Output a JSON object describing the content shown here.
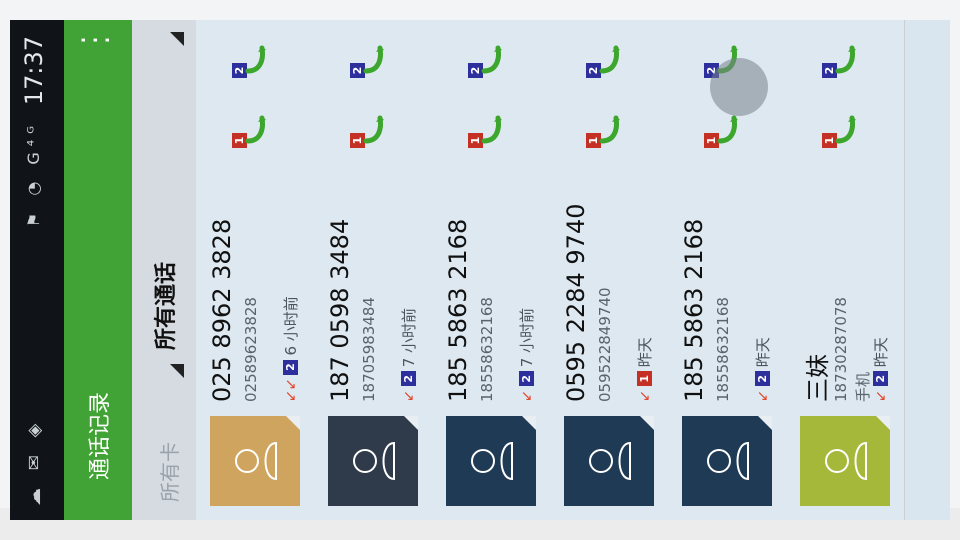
{
  "status_bar": {
    "time": "17:37",
    "icons_left": "☁ ✉ ◈",
    "icons_right": "⚑ ◔ G⁴ᴳ"
  },
  "action_bar": {
    "title": "通话记录",
    "menu_icon": "overflow-menu-icon"
  },
  "filter_bar": {
    "left_label": "所有卡",
    "main_label": "所有通话"
  },
  "calls": [
    {
      "name": "025 8962 3828",
      "number": "02589623828",
      "type_label": "",
      "arrows": "↙↙",
      "sim": "2",
      "time": "6 小时前",
      "avatar_style": "gold",
      "right_btns": [
        {
          "sim": "2"
        },
        {
          "sim": "1"
        }
      ]
    },
    {
      "name": "187 0598 3484",
      "number": "18705983484",
      "type_label": "",
      "arrows": "↙",
      "sim": "2",
      "time": "7 小时前",
      "avatar_style": "dark",
      "right_btns": [
        {
          "sim": "2"
        },
        {
          "sim": "1"
        }
      ]
    },
    {
      "name": "185 5863 2168",
      "number": "18558632168",
      "type_label": "",
      "arrows": "↙",
      "sim": "2",
      "time": "7 小时前",
      "avatar_style": "navy",
      "right_btns": [
        {
          "sim": "2"
        },
        {
          "sim": "1"
        }
      ]
    },
    {
      "name": "0595 2284 9740",
      "number": "059522849740",
      "type_label": "",
      "arrows": "↙",
      "sim": "1",
      "time": "昨天",
      "avatar_style": "navy",
      "right_btns": [
        {
          "sim": "2"
        },
        {
          "sim": "1"
        }
      ]
    },
    {
      "name": "185 5863 2168",
      "number": "18558632168",
      "type_label": "",
      "arrows": "↙",
      "sim": "2",
      "time": "昨天",
      "avatar_style": "navy",
      "right_btns": [
        {
          "sim": "2"
        },
        {
          "sim": "1"
        }
      ]
    },
    {
      "name": "三妹",
      "number": "18730287078",
      "type_label": "手机",
      "arrows": "↙",
      "sim": "2",
      "time": "昨天",
      "avatar_style": "olive",
      "right_btns": [
        {
          "sim": "2"
        },
        {
          "sim": "1"
        }
      ]
    }
  ],
  "colors": {
    "accent_green": "#41a335",
    "sim1": "#c43124",
    "sim2": "#2d2f9c",
    "missed_arrow": "#e3452b"
  }
}
